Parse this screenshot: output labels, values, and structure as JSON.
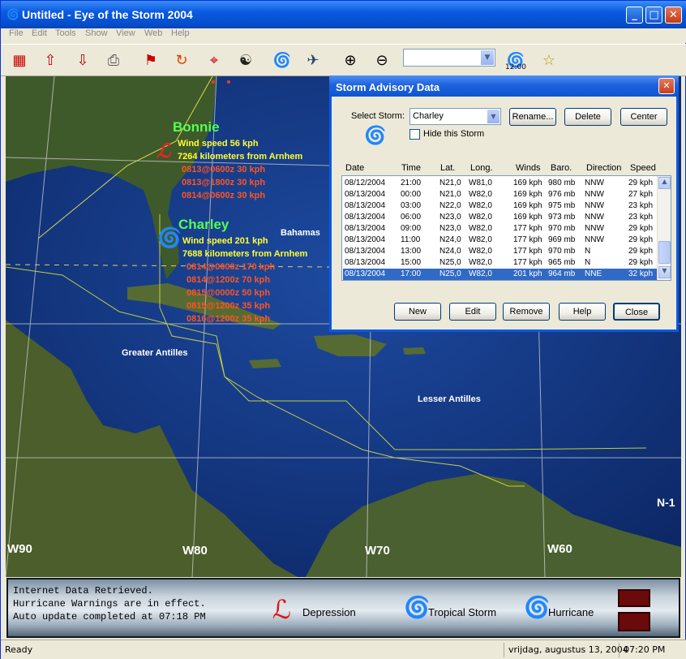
{
  "window": {
    "title": "Untitled - Eye of the Storm 2004"
  },
  "menu": [
    "File",
    "Edit",
    "Tools",
    "Show",
    "View",
    "Web",
    "Help"
  ],
  "toolbar": {
    "clock": "12:00",
    "zoom_value": ""
  },
  "map": {
    "storms": [
      {
        "name": "Bonnie",
        "wind": "Wind speed 56 kph",
        "distance": "7264 kilometers from Arnhem",
        "forecasts": [
          "0813@0600z 30 kph",
          "0813@1800z 30 kph",
          "0814@0600z 30 kph"
        ]
      },
      {
        "name": "Charley",
        "wind": "Wind speed 201 kph",
        "distance": "7688 kilometers from Arnhem",
        "forecasts": [
          "0814@0000z 170 kph",
          "0814@1200z 70 kph",
          "0815@0000z 50 kph",
          "0815@1200z 35 kph",
          "0816@1200z 35 kph"
        ]
      }
    ],
    "places": {
      "bahamas": "Bahamas",
      "greater_antilles": "Greater Antilles",
      "lesser_antilles": "Lesser Antilles"
    },
    "longitudes": [
      "W90",
      "W80",
      "W70",
      "W60"
    ],
    "latitude": "N-1"
  },
  "legend": {
    "messages": [
      "Internet Data Retrieved.",
      "Hurricane Warnings are in effect.",
      "Auto update completed at 07:18  PM"
    ],
    "depression": "Depression",
    "tropical_storm": "Tropical Storm",
    "hurricane": "Hurricane"
  },
  "dialog": {
    "title": "Storm Advisory Data",
    "select_label": "Select Storm:",
    "selected_storm": "Charley",
    "rename": "Rename...",
    "delete": "Delete",
    "center": "Center",
    "hide_label": "Hide this Storm",
    "columns": [
      "Date",
      "Time",
      "Lat.",
      "Long.",
      "Winds",
      "Baro.",
      "Direction",
      "Speed"
    ],
    "rows": [
      [
        "08/12/2004",
        "21:00",
        "N21,0",
        "W81,0",
        "169 kph",
        "980 mb",
        "NNW",
        "29 kph"
      ],
      [
        "08/13/2004",
        "00:00",
        "N21,0",
        "W82,0",
        "169 kph",
        "976 mb",
        "NNW",
        "27 kph"
      ],
      [
        "08/13/2004",
        "03:00",
        "N22,0",
        "W82,0",
        "169 kph",
        "975 mb",
        "NNW",
        "23 kph"
      ],
      [
        "08/13/2004",
        "06:00",
        "N23,0",
        "W82,0",
        "169 kph",
        "973 mb",
        "NNW",
        "23 kph"
      ],
      [
        "08/13/2004",
        "09:00",
        "N23,0",
        "W82,0",
        "177 kph",
        "970 mb",
        "NNW",
        "29 kph"
      ],
      [
        "08/13/2004",
        "11:00",
        "N24,0",
        "W82,0",
        "177 kph",
        "969 mb",
        "NNW",
        "29 kph"
      ],
      [
        "08/13/2004",
        "13:00",
        "N24,0",
        "W82,0",
        "177 kph",
        "970 mb",
        "N",
        "29 kph"
      ],
      [
        "08/13/2004",
        "15:00",
        "N25,0",
        "W82,0",
        "177 kph",
        "965 mb",
        "N",
        "29 kph"
      ],
      [
        "08/13/2004",
        "17:00",
        "N25,0",
        "W82,0",
        "201 kph",
        "964 mb",
        "NNE",
        "32 kph"
      ]
    ],
    "selected_row": 8,
    "buttons": {
      "new": "New",
      "edit": "Edit",
      "remove": "Remove",
      "help": "Help",
      "close": "Close"
    }
  },
  "status": {
    "left": "Ready",
    "date": "vrijdag, augustus 13, 2004",
    "time": "07:20 PM"
  }
}
